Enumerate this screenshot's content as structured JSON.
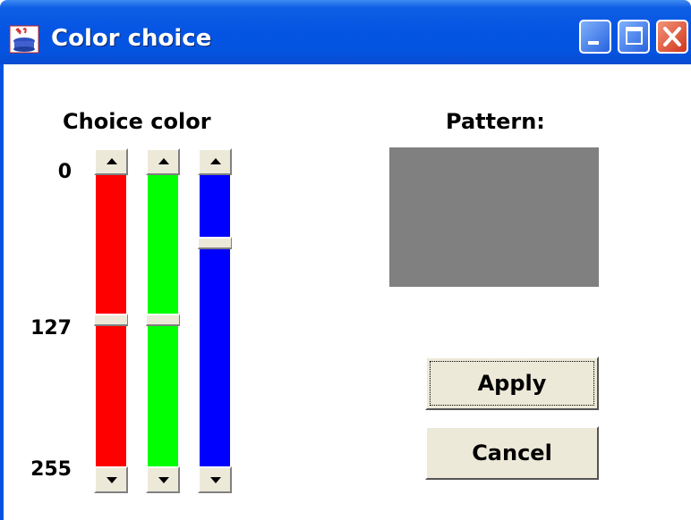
{
  "window": {
    "title": "Color choice",
    "controls": [
      "minimize",
      "maximize",
      "close"
    ]
  },
  "panel": {
    "heading": "Choice color",
    "scale_labels": [
      "0",
      "127",
      "255"
    ],
    "channels": [
      {
        "name": "red",
        "color": "#ff0000",
        "value": 127
      },
      {
        "name": "green",
        "color": "#00ff00",
        "value": 127
      },
      {
        "name": "blue",
        "color": "#0000ff",
        "value": 56
      }
    ]
  },
  "preview": {
    "heading": "Pattern:",
    "color": "#808080"
  },
  "buttons": {
    "apply": "Apply",
    "cancel": "Cancel"
  }
}
